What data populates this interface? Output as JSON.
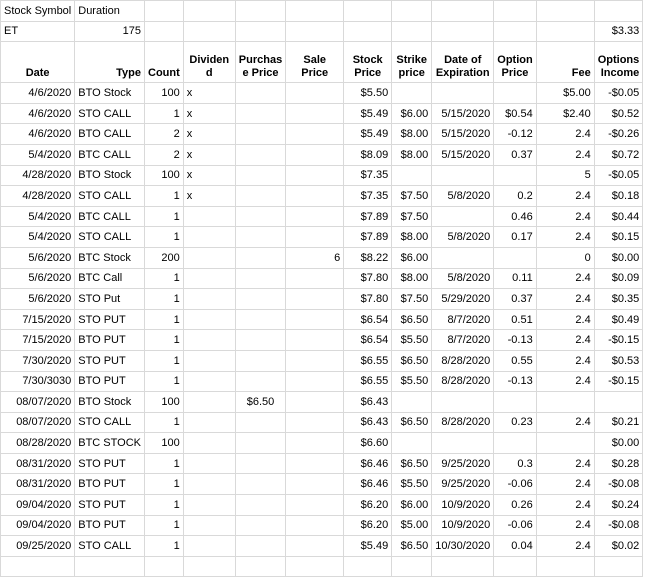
{
  "info": {
    "symbol_label": "Stock Symbol",
    "duration_label": "Duration",
    "symbol": "ET",
    "duration": "175",
    "total_income": "$3.33"
  },
  "headers": {
    "date": "Date",
    "type": "Type",
    "count": "Count",
    "dividend": "Dividen d",
    "purchase_price": "Purchas e Price",
    "sale_price": "Sale Price",
    "stock_price": "Stock Price",
    "strike_price": "Strike price",
    "expiration": "Date of Expiration",
    "option_price": "Option Price",
    "fee": "Fee",
    "options_income": "Options Income"
  },
  "rows": [
    {
      "date": "4/6/2020",
      "type": "BTO Stock",
      "count": "100",
      "dividend": "x",
      "purchase": "",
      "sale": "",
      "stock": "$5.50",
      "strike": "",
      "exp": "",
      "option": "",
      "fee": "$5.00",
      "income": "-$0.05"
    },
    {
      "date": "4/6/2020",
      "type": "STO CALL",
      "count": "1",
      "dividend": "x",
      "purchase": "",
      "sale": "",
      "stock": "$5.49",
      "strike": "$6.00",
      "exp": "5/15/2020",
      "option": "$0.54",
      "fee": "$2.40",
      "income": "$0.52"
    },
    {
      "date": "4/6/2020",
      "type": "BTO CALL",
      "count": "2",
      "dividend": "x",
      "purchase": "",
      "sale": "",
      "stock": "$5.49",
      "strike": "$8.00",
      "exp": "5/15/2020",
      "option": "-0.12",
      "fee": "2.4",
      "income": "-$0.26"
    },
    {
      "date": "5/4/2020",
      "type": "BTC CALL",
      "count": "2",
      "dividend": "x",
      "purchase": "",
      "sale": "",
      "stock": "$8.09",
      "strike": "$8.00",
      "exp": "5/15/2020",
      "option": "0.37",
      "fee": "2.4",
      "income": "$0.72"
    },
    {
      "date": "4/28/2020",
      "type": "BTO Stock",
      "count": "100",
      "dividend": "x",
      "purchase": "",
      "sale": "",
      "stock": "$7.35",
      "strike": "",
      "exp": "",
      "option": "",
      "fee": "5",
      "income": "-$0.05"
    },
    {
      "date": "4/28/2020",
      "type": "STO CALL",
      "count": "1",
      "dividend": "x",
      "purchase": "",
      "sale": "",
      "stock": "$7.35",
      "strike": "$7.50",
      "exp": "5/8/2020",
      "option": "0.2",
      "fee": "2.4",
      "income": "$0.18"
    },
    {
      "date": "5/4/2020",
      "type": "BTC CALL",
      "count": "1",
      "dividend": "",
      "purchase": "",
      "sale": "",
      "stock": "$7.89",
      "strike": "$7.50",
      "exp": "",
      "option": "0.46",
      "fee": "2.4",
      "income": "$0.44"
    },
    {
      "date": "5/4/2020",
      "type": "STO CALL",
      "count": "1",
      "dividend": "",
      "purchase": "",
      "sale": "",
      "stock": "$7.89",
      "strike": "$8.00",
      "exp": "5/8/2020",
      "option": "0.17",
      "fee": "2.4",
      "income": "$0.15"
    },
    {
      "date": "5/6/2020",
      "type": "BTC Stock",
      "count": "200",
      "dividend": "",
      "purchase": "",
      "sale": "6",
      "stock": "$8.22",
      "strike": "$6.00",
      "exp": "",
      "option": "",
      "fee": "0",
      "income": "$0.00"
    },
    {
      "date": "5/6/2020",
      "type": "BTC Call",
      "count": "1",
      "dividend": "",
      "purchase": "",
      "sale": "",
      "stock": "$7.80",
      "strike": "$8.00",
      "exp": "5/8/2020",
      "option": "0.11",
      "fee": "2.4",
      "income": "$0.09"
    },
    {
      "date": "5/6/2020",
      "type": "STO Put",
      "count": "1",
      "dividend": "",
      "purchase": "",
      "sale": "",
      "stock": "$7.80",
      "strike": "$7.50",
      "exp": "5/29/2020",
      "option": "0.37",
      "fee": "2.4",
      "income": "$0.35"
    },
    {
      "date": "7/15/2020",
      "type": "STO PUT",
      "count": "1",
      "dividend": "",
      "purchase": "",
      "sale": "",
      "stock": "$6.54",
      "strike": "$6.50",
      "exp": "8/7/2020",
      "option": "0.51",
      "fee": "2.4",
      "income": "$0.49"
    },
    {
      "date": "7/15/2020",
      "type": "BTO PUT",
      "count": "1",
      "dividend": "",
      "purchase": "",
      "sale": "",
      "stock": "$6.54",
      "strike": "$5.50",
      "exp": "8/7/2020",
      "option": "-0.13",
      "fee": "2.4",
      "income": "-$0.15"
    },
    {
      "date": "7/30/2020",
      "type": "STO PUT",
      "count": "1",
      "dividend": "",
      "purchase": "",
      "sale": "",
      "stock": "$6.55",
      "strike": "$6.50",
      "exp": "8/28/2020",
      "option": "0.55",
      "fee": "2.4",
      "income": "$0.53"
    },
    {
      "date": "7/30/3030",
      "type": "BTO PUT",
      "count": "1",
      "dividend": "",
      "purchase": "",
      "sale": "",
      "stock": "$6.55",
      "strike": "$5.50",
      "exp": "8/28/2020",
      "option": "-0.13",
      "fee": "2.4",
      "income": "-$0.15"
    },
    {
      "date": "08/07/2020",
      "type": "BTO Stock",
      "count": "100",
      "dividend": "",
      "purchase": "$6.50",
      "sale": "",
      "stock": "$6.43",
      "strike": "",
      "exp": "",
      "option": "",
      "fee": "",
      "income": ""
    },
    {
      "date": "08/07/2020",
      "type": "STO CALL",
      "count": "1",
      "dividend": "",
      "purchase": "",
      "sale": "",
      "stock": "$6.43",
      "strike": "$6.50",
      "exp": "8/28/2020",
      "option": "0.23",
      "fee": "2.4",
      "income": "$0.21"
    },
    {
      "date": "08/28/2020",
      "type": "BTC STOCK",
      "count": "100",
      "dividend": "",
      "purchase": "",
      "sale": "",
      "stock": "$6.60",
      "strike": "",
      "exp": "",
      "option": "",
      "fee": "",
      "income": "$0.00"
    },
    {
      "date": "08/31/2020",
      "type": "STO PUT",
      "count": "1",
      "dividend": "",
      "purchase": "",
      "sale": "",
      "stock": "$6.46",
      "strike": "$6.50",
      "exp": "9/25/2020",
      "option": "0.3",
      "fee": "2.4",
      "income": "$0.28"
    },
    {
      "date": "08/31/2020",
      "type": "BTO PUT",
      "count": "1",
      "dividend": "",
      "purchase": "",
      "sale": "",
      "stock": "$6.46",
      "strike": "$5.50",
      "exp": "9/25/2020",
      "option": "-0.06",
      "fee": "2.4",
      "income": "-$0.08"
    },
    {
      "date": "09/04/2020",
      "type": "STO PUT",
      "count": "1",
      "dividend": "",
      "purchase": "",
      "sale": "",
      "stock": "$6.20",
      "strike": "$6.00",
      "exp": "10/9/2020",
      "option": "0.26",
      "fee": "2.4",
      "income": "$0.24"
    },
    {
      "date": "09/04/2020",
      "type": "BTO PUT",
      "count": "1",
      "dividend": "",
      "purchase": "",
      "sale": "",
      "stock": "$6.20",
      "strike": "$5.00",
      "exp": "10/9/2020",
      "option": "-0.06",
      "fee": "2.4",
      "income": "-$0.08"
    },
    {
      "date": "09/25/2020",
      "type": "STO CALL",
      "count": "1",
      "dividend": "",
      "purchase": "",
      "sale": "",
      "stock": "$5.49",
      "strike": "$6.50",
      "exp": "10/30/2020",
      "option": "0.04",
      "fee": "2.4",
      "income": "$0.02"
    },
    {
      "date": "",
      "type": "",
      "count": "",
      "dividend": "",
      "purchase": "",
      "sale": "",
      "stock": "",
      "strike": "",
      "exp": "",
      "option": "",
      "fee": "",
      "income": ""
    }
  ]
}
